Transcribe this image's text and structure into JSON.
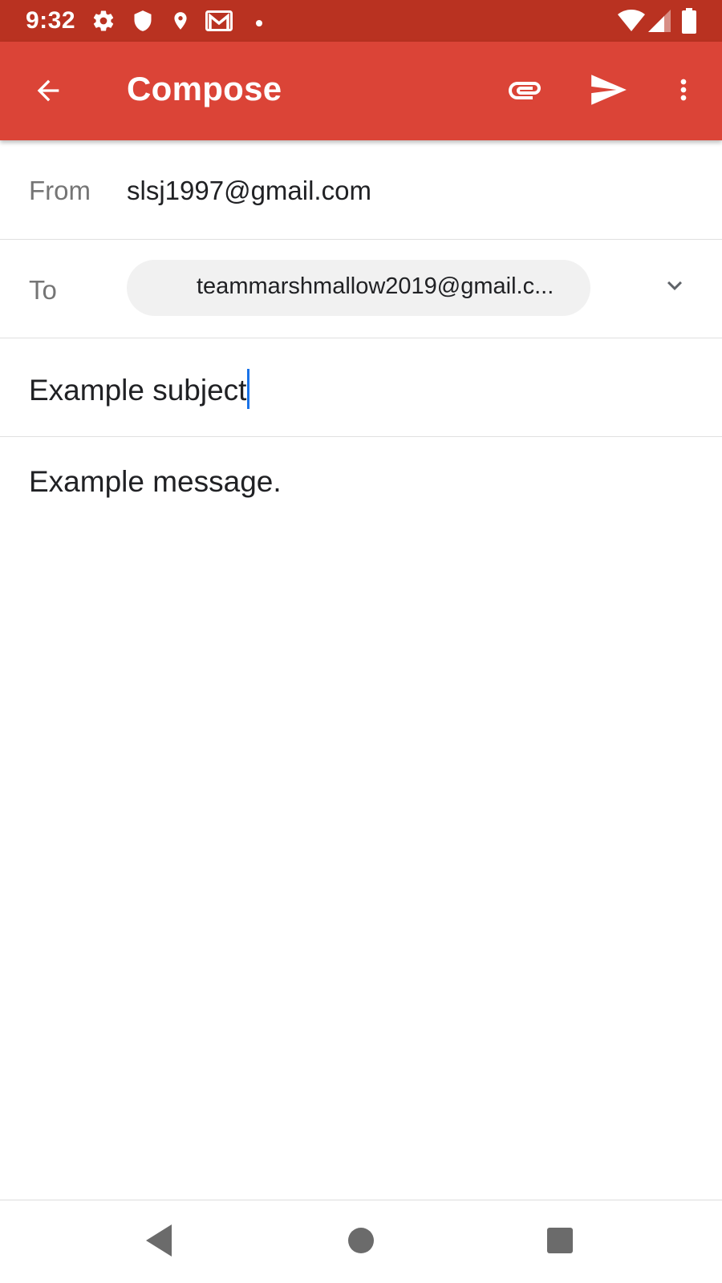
{
  "status_bar": {
    "time": "9:32",
    "icons_left": [
      "settings-icon",
      "shield-icon",
      "location-icon",
      "gmail-icon",
      "dot-icon"
    ],
    "icons_right": [
      "wifi-icon",
      "signal-icon",
      "battery-icon"
    ],
    "background_color": "#b93221"
  },
  "app_bar": {
    "title": "Compose",
    "background_color": "#db4437",
    "actions": [
      "attach-icon",
      "send-icon",
      "more-vert-icon"
    ]
  },
  "form": {
    "from_label": "From",
    "from_value": "slsj1997@gmail.com",
    "to_label": "To",
    "to_recipient": "teammarshmallow2019@gmail.c...",
    "subject_value": "Example subject",
    "body_value": "Example message."
  },
  "accent_color": "#1a73e8",
  "nav_bar": {
    "buttons": [
      "back-icon",
      "home-icon",
      "recents-icon"
    ]
  }
}
